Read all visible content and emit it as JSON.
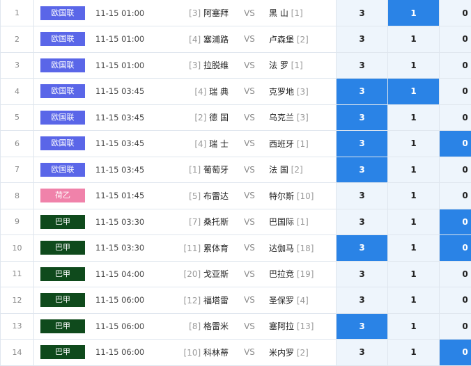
{
  "vs_label": "VS",
  "league_colors": {
    "欧国联": "#5a66e8",
    "荷乙": "#f082aa",
    "巴甲": "#0f4a1c"
  },
  "odds_highlight_color": "#2a83e6",
  "rows": [
    {
      "no": "1",
      "league": "欧国联",
      "time": "11-15 01:00",
      "home_rank": "[3]",
      "home": "阿塞拜",
      "away": "黑 山",
      "away_rank": "[1]",
      "odds": [
        "3",
        "1",
        "0"
      ],
      "hl": [
        false,
        true,
        false
      ]
    },
    {
      "no": "2",
      "league": "欧国联",
      "time": "11-15 01:00",
      "home_rank": "[4]",
      "home": "塞浦路",
      "away": "卢森堡",
      "away_rank": "[2]",
      "odds": [
        "3",
        "1",
        "0"
      ],
      "hl": [
        false,
        false,
        false
      ]
    },
    {
      "no": "3",
      "league": "欧国联",
      "time": "11-15 01:00",
      "home_rank": "[3]",
      "home": "拉脱维",
      "away": "法 罗",
      "away_rank": "[1]",
      "odds": [
        "3",
        "1",
        "0"
      ],
      "hl": [
        false,
        false,
        false
      ]
    },
    {
      "no": "4",
      "league": "欧国联",
      "time": "11-15 03:45",
      "home_rank": "[4]",
      "home": "瑞 典",
      "away": "克罗地",
      "away_rank": "[3]",
      "odds": [
        "3",
        "1",
        "0"
      ],
      "hl": [
        true,
        true,
        false
      ]
    },
    {
      "no": "5",
      "league": "欧国联",
      "time": "11-15 03:45",
      "home_rank": "[2]",
      "home": "德 国",
      "away": "乌克兰",
      "away_rank": "[3]",
      "odds": [
        "3",
        "1",
        "0"
      ],
      "hl": [
        true,
        false,
        false
      ]
    },
    {
      "no": "6",
      "league": "欧国联",
      "time": "11-15 03:45",
      "home_rank": "[4]",
      "home": "瑞 士",
      "away": "西班牙",
      "away_rank": "[1]",
      "odds": [
        "3",
        "1",
        "0"
      ],
      "hl": [
        true,
        false,
        true
      ]
    },
    {
      "no": "7",
      "league": "欧国联",
      "time": "11-15 03:45",
      "home_rank": "[1]",
      "home": "葡萄牙",
      "away": "法 国",
      "away_rank": "[2]",
      "odds": [
        "3",
        "1",
        "0"
      ],
      "hl": [
        true,
        false,
        false
      ]
    },
    {
      "no": "8",
      "league": "荷乙",
      "time": "11-15 01:45",
      "home_rank": "[5]",
      "home": "布雷达",
      "away": "特尔斯",
      "away_rank": "[10]",
      "odds": [
        "3",
        "1",
        "0"
      ],
      "hl": [
        false,
        false,
        false
      ]
    },
    {
      "no": "9",
      "league": "巴甲",
      "time": "11-15 03:30",
      "home_rank": "[7]",
      "home": "桑托斯",
      "away": "巴国际",
      "away_rank": "[1]",
      "odds": [
        "3",
        "1",
        "0"
      ],
      "hl": [
        false,
        false,
        true
      ]
    },
    {
      "no": "10",
      "league": "巴甲",
      "time": "11-15 03:30",
      "home_rank": "[11]",
      "home": "累体育",
      "away": "达伽马",
      "away_rank": "[18]",
      "odds": [
        "3",
        "1",
        "0"
      ],
      "hl": [
        true,
        false,
        true
      ]
    },
    {
      "no": "11",
      "league": "巴甲",
      "time": "11-15 04:00",
      "home_rank": "[20]",
      "home": "戈亚斯",
      "away": "巴拉竞",
      "away_rank": "[19]",
      "odds": [
        "3",
        "1",
        "0"
      ],
      "hl": [
        false,
        false,
        false
      ]
    },
    {
      "no": "12",
      "league": "巴甲",
      "time": "11-15 06:00",
      "home_rank": "[12]",
      "home": "福塔雷",
      "away": "圣保罗",
      "away_rank": "[4]",
      "odds": [
        "3",
        "1",
        "0"
      ],
      "hl": [
        false,
        false,
        false
      ]
    },
    {
      "no": "13",
      "league": "巴甲",
      "time": "11-15 06:00",
      "home_rank": "[8]",
      "home": "格雷米",
      "away": "塞阿拉",
      "away_rank": "[13]",
      "odds": [
        "3",
        "1",
        "0"
      ],
      "hl": [
        true,
        false,
        false
      ]
    },
    {
      "no": "14",
      "league": "巴甲",
      "time": "11-15 06:00",
      "home_rank": "[10]",
      "home": "科林蒂",
      "away": "米内罗",
      "away_rank": "[2]",
      "odds": [
        "3",
        "1",
        "0"
      ],
      "hl": [
        false,
        false,
        true
      ]
    }
  ]
}
